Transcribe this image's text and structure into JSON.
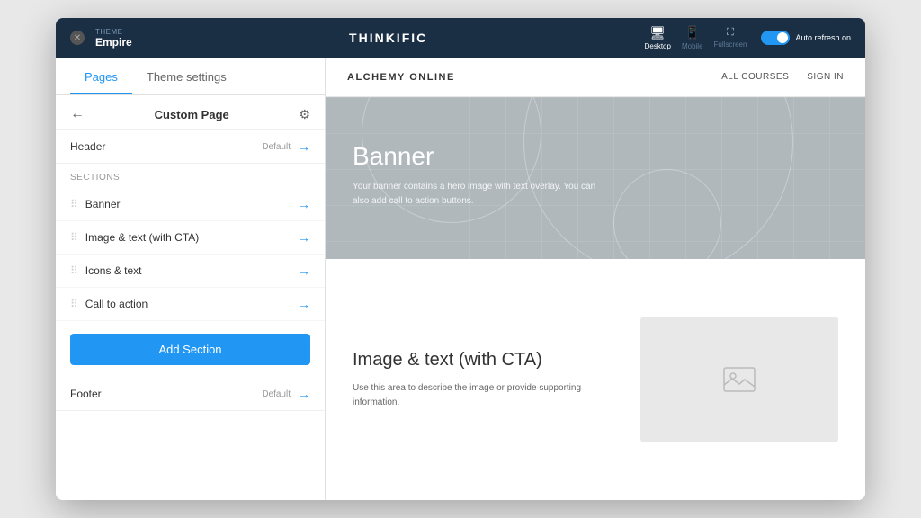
{
  "topbar": {
    "close_label": "✕",
    "theme_label": "THEME",
    "theme_name": "Empire",
    "title": "THINKIFIC",
    "devices": [
      {
        "label": "Desktop",
        "active": true,
        "icon": "🖥"
      },
      {
        "label": "Mobile",
        "active": false,
        "icon": "📱"
      },
      {
        "label": "Fullscreen",
        "active": false,
        "icon": "⛶"
      }
    ],
    "toggle_label": "Auto refresh on"
  },
  "sidebar": {
    "tabs": [
      {
        "label": "Pages",
        "active": true
      },
      {
        "label": "Theme settings",
        "active": false
      }
    ],
    "page_title": "Custom Page",
    "header": {
      "label": "Header",
      "default": "Default"
    },
    "sections_label": "Sections",
    "sections": [
      {
        "name": "Banner"
      },
      {
        "name": "Image & text (with CTA)"
      },
      {
        "name": "Icons & text"
      },
      {
        "name": "Call to action"
      }
    ],
    "add_section_label": "Add Section",
    "footer": {
      "label": "Footer",
      "default": "Default"
    }
  },
  "preview": {
    "nav": {
      "logo": "ALCHEMY ONLINE",
      "links": [
        "ALL COURSES",
        "SIGN IN"
      ]
    },
    "banner": {
      "title": "Banner",
      "description": "Your banner contains a hero image with text overlay. You can also add call to action buttons."
    },
    "image_text": {
      "title": "Image & text (with CTA)",
      "description": "Use this area to describe the image or provide supporting information."
    }
  }
}
